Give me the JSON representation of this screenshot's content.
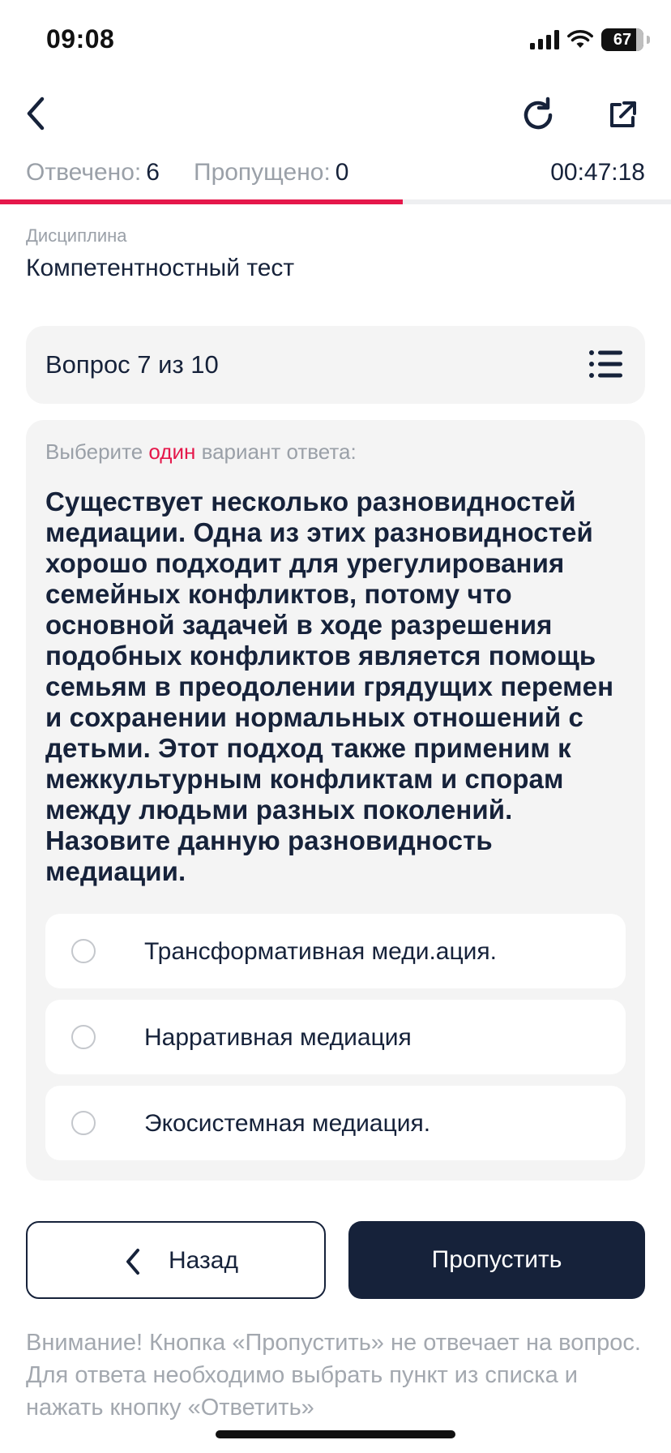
{
  "status_bar": {
    "time": "09:08",
    "battery": "67"
  },
  "nav": {
    "back_icon": "chevron-left-icon",
    "refresh_icon": "refresh-icon",
    "share_icon": "external-link-icon"
  },
  "stats": {
    "answered_label": "Отвечено:",
    "answered_value": "6",
    "skipped_label": "Пропущено:",
    "skipped_value": "0",
    "timer": "00:47:18"
  },
  "progress": {
    "fraction": 0.6,
    "color": "#e5184b"
  },
  "discipline": {
    "label": "Дисциплина",
    "value": "Компетентностный тест"
  },
  "question": {
    "counter": "Вопрос 7 из 10",
    "instruction_before": "Выберите",
    "instruction_accent": "один",
    "instruction_after": "вариант ответа:",
    "text": "Существует несколько разновидностей медиации. Одна из этих разновидностей хорошо подходит для урегулирования семейных конфликтов, потому что основной задачей в ходе разрешения подобных конфликтов является помощь семьям в преодолении грядущих перемен и сохранении нормальных отношений с детьми. Этот подход также применим к межкультурным конфликтам и спорам между людьми разных поколений. Назовите данную разновидность медиации."
  },
  "options": [
    {
      "label": "Трансформативная меди.ация."
    },
    {
      "label": "Нарративная медиация"
    },
    {
      "label": "Экосистемная медиация."
    }
  ],
  "buttons": {
    "back_label": "Назад",
    "skip_label": "Пропустить"
  },
  "notice": "Внимание! Кнопка «Пропустить» не отвечает на вопрос. Для ответа необходимо выбрать пункт из списка и нажать кнопку «Ответить»",
  "colors": {
    "primary": "#16223a",
    "accent": "#e5184b",
    "muted": "#9aa0a8",
    "card": "#f4f4f4"
  }
}
